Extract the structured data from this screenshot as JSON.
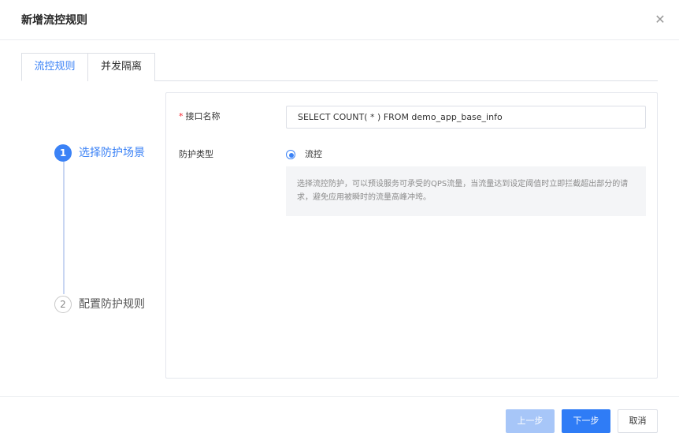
{
  "dialog": {
    "title": "新增流控规则",
    "close_icon": "close-icon"
  },
  "tabs": [
    {
      "label": "流控规则",
      "active": true
    },
    {
      "label": "并发隔离",
      "active": false
    }
  ],
  "steps": [
    {
      "number": "1",
      "label": "选择防护场景",
      "active": true
    },
    {
      "number": "2",
      "label": "配置防护规则",
      "active": false
    }
  ],
  "form": {
    "interface_name": {
      "required_mark": "*",
      "label": "接口名称",
      "value": "SELECT COUNT( * ) FROM demo_app_base_info"
    },
    "protection_type": {
      "label": "防护类型",
      "option_label": "流控",
      "selected": true,
      "description": "选择流控防护，可以预设服务可承受的QPS流量，当流量达到设定阈值时立即拦截超出部分的请求，避免应用被瞬时的流量高峰冲垮。"
    }
  },
  "footer": {
    "prev_label": "上一步",
    "next_label": "下一步",
    "cancel_label": "取消"
  },
  "colors": {
    "accent": "#3b82f6",
    "next_button": "#2f7cf6",
    "prev_button_disabled": "#a7c6f8",
    "required": "#f5222d"
  }
}
